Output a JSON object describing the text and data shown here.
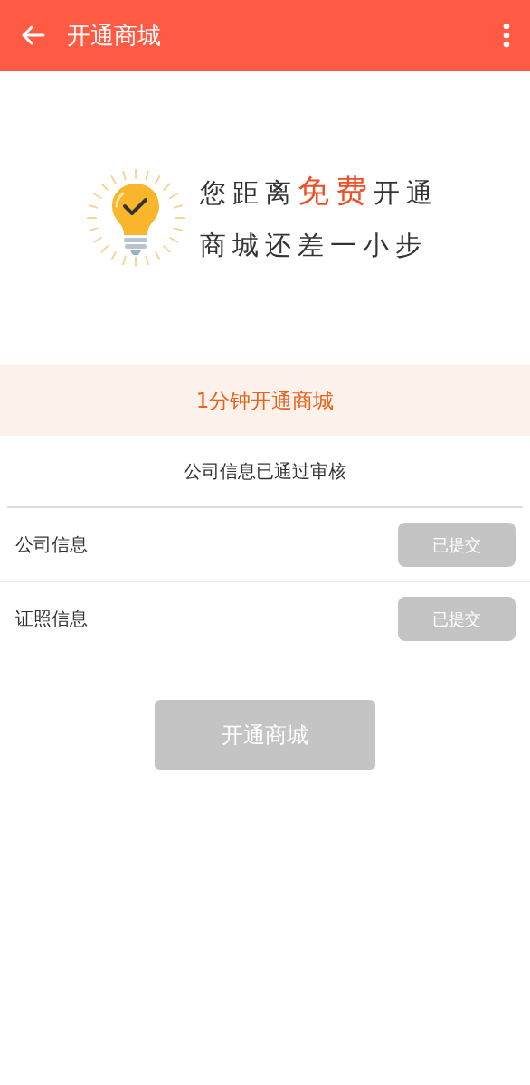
{
  "header": {
    "title": "开通商城"
  },
  "banner": {
    "line_1": [
      {
        "text": "您距离",
        "highlight": false
      },
      {
        "text": "免费",
        "highlight": true
      },
      {
        "text": "开通",
        "highlight": false
      }
    ],
    "line_2": "商城还差一小步"
  },
  "promo": {
    "title": "1分钟开通商城"
  },
  "status": "公司信息已通过审核",
  "rows": [
    {
      "label": "公司信息",
      "button": "已提交",
      "disabled": true
    },
    {
      "label": "证照信息",
      "button": "已提交",
      "disabled": true
    }
  ],
  "submit": {
    "label": "开通商城",
    "disabled": true
  }
}
